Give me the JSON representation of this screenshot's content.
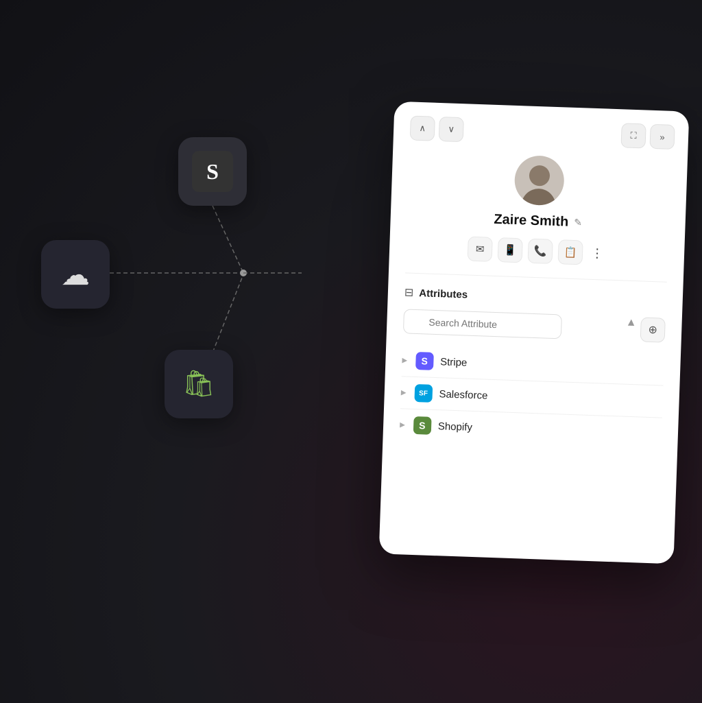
{
  "background": {
    "color": "#1a1a1f"
  },
  "icons": [
    {
      "id": "squarespace",
      "label": "S",
      "type": "squarespace",
      "position": "top-center"
    },
    {
      "id": "salesforce",
      "label": "☁",
      "type": "cloud",
      "position": "middle-left"
    },
    {
      "id": "shopify",
      "label": "S",
      "type": "shopify",
      "position": "bottom"
    }
  ],
  "card": {
    "nav": {
      "up_label": "∧",
      "down_label": "∨",
      "expand_label": "⛶",
      "forward_label": "»"
    },
    "profile": {
      "name": "Zaire Smith",
      "edit_label": "✎"
    },
    "actions": [
      {
        "id": "email",
        "icon": "✉",
        "label": "Email"
      },
      {
        "id": "phone",
        "icon": "▭",
        "label": "Phone"
      },
      {
        "id": "call",
        "icon": "✆",
        "label": "Call"
      },
      {
        "id": "note",
        "icon": "▤",
        "label": "Note"
      },
      {
        "id": "more",
        "icon": "⋮",
        "label": "More"
      }
    ],
    "attributes": {
      "section_label": "Attributes",
      "section_icon": "⊞",
      "search_placeholder": "Search Attribute",
      "add_button_label": "⊕",
      "integrations": [
        {
          "id": "stripe",
          "name": "Stripe",
          "logo_letter": "S",
          "logo_color": "#635bff"
        },
        {
          "id": "salesforce",
          "name": "Salesforce",
          "logo_letter": "SF",
          "logo_color": "#00a1e0"
        },
        {
          "id": "shopify",
          "name": "Shopify",
          "logo_letter": "S",
          "logo_color": "#5a8a3c"
        }
      ]
    }
  }
}
